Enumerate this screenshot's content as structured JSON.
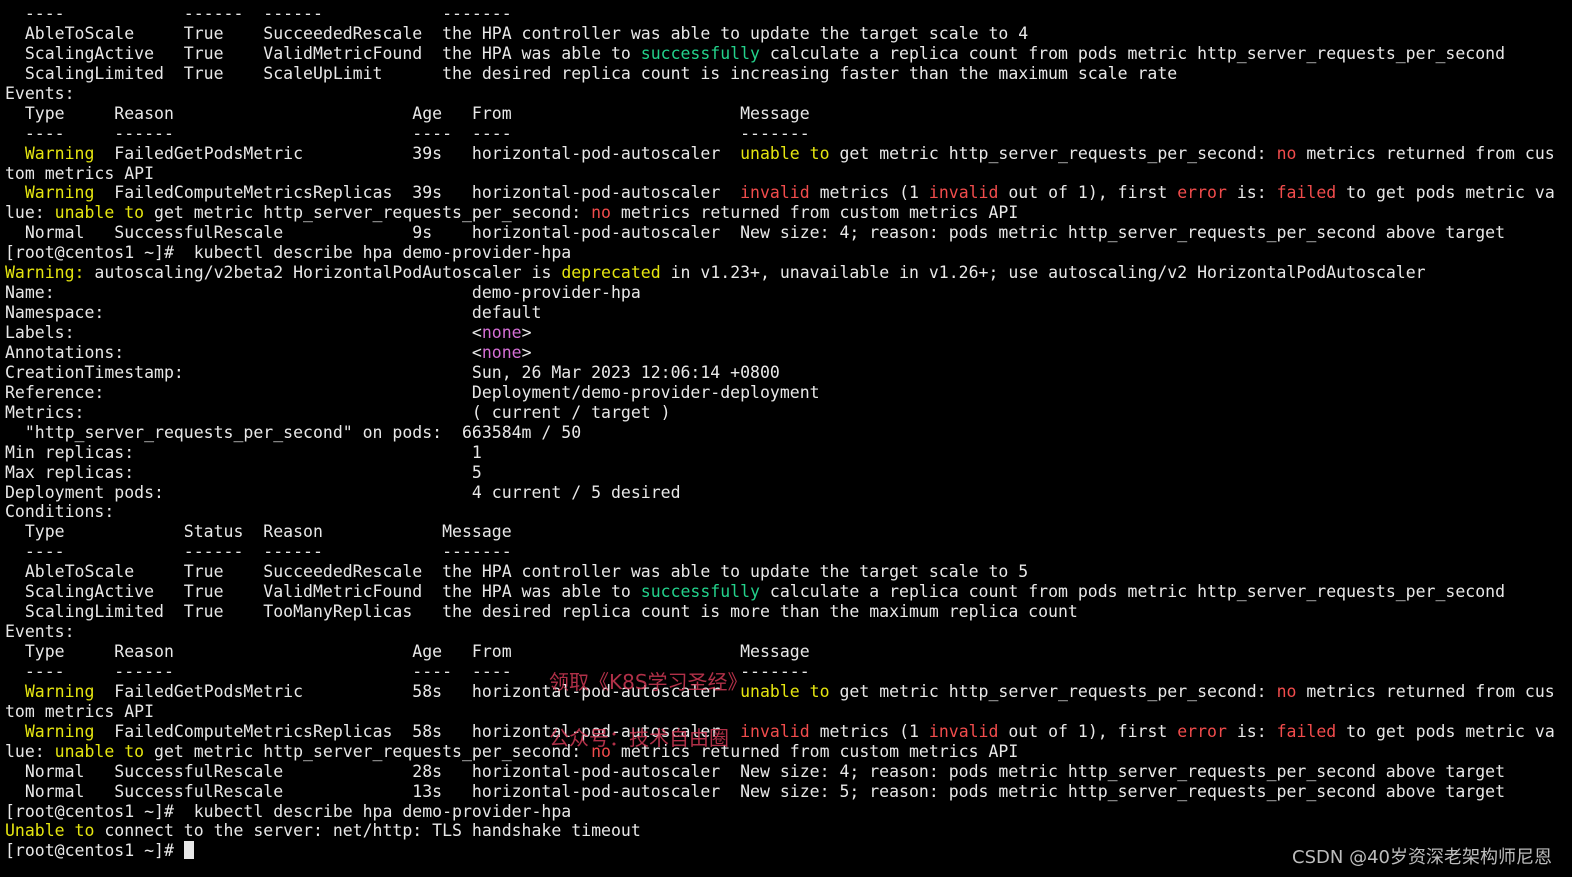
{
  "terminal": {
    "lines": [
      [
        {
          "t": "  ----            ------  ------            -------"
        }
      ],
      [
        {
          "t": "  AbleToScale     True    SucceededRescale  the HPA controller was able to update the target scale to 4"
        }
      ],
      [
        {
          "t": "  ScalingActive   True    ValidMetricFound  the HPA was able to "
        },
        {
          "t": "successfully",
          "c": "g"
        },
        {
          "t": " calculate a replica count from pods metric http_server_requests_per_second"
        }
      ],
      [
        {
          "t": "  ScalingLimited  True    ScaleUpLimit      the desired replica count is increasing faster than the maximum scale rate"
        }
      ],
      [
        {
          "t": "Events:"
        }
      ],
      [
        {
          "t": "  Type     Reason                        Age   From                       Message"
        }
      ],
      [
        {
          "t": "  ----     ------                        ----  ----                       -------"
        }
      ],
      [
        {
          "t": "  "
        },
        {
          "t": "Warning",
          "c": "y"
        },
        {
          "t": "  FailedGetPodsMetric           39s   horizontal-pod-autoscaler  "
        },
        {
          "t": "unable to",
          "c": "y"
        },
        {
          "t": " get metric http_server_requests_per_second: "
        },
        {
          "t": "no",
          "c": "r"
        },
        {
          "t": " metrics returned from cus"
        }
      ],
      [
        {
          "t": "tom metrics API"
        }
      ],
      [
        {
          "t": "  "
        },
        {
          "t": "Warning",
          "c": "y"
        },
        {
          "t": "  FailedComputeMetricsReplicas  39s   horizontal-pod-autoscaler  "
        },
        {
          "t": "invalid",
          "c": "r"
        },
        {
          "t": " metrics (1 "
        },
        {
          "t": "invalid",
          "c": "r"
        },
        {
          "t": " out of 1), first "
        },
        {
          "t": "error",
          "c": "r"
        },
        {
          "t": " is: "
        },
        {
          "t": "failed",
          "c": "r"
        },
        {
          "t": " to get pods metric va"
        }
      ],
      [
        {
          "t": "lue: "
        },
        {
          "t": "unable to",
          "c": "y"
        },
        {
          "t": " get metric http_server_requests_per_second: "
        },
        {
          "t": "no",
          "c": "r"
        },
        {
          "t": " metrics returned from custom metrics API"
        }
      ],
      [
        {
          "t": "  Normal   SuccessfulRescale             9s    horizontal-pod-autoscaler  New size: 4; reason: pods metric http_server_requests_per_second above target"
        }
      ],
      [
        {
          "t": "[root@centos1 ~]#  kubectl describe hpa demo-provider-hpa"
        }
      ],
      [
        {
          "t": "Warning:",
          "c": "y"
        },
        {
          "t": " autoscaling/v2beta2 HorizontalPodAutoscaler is "
        },
        {
          "t": "deprecated",
          "c": "y"
        },
        {
          "t": " in v1.23+, unavailable in v1.26+; use autoscaling/v2 HorizontalPodAutoscaler"
        }
      ],
      [
        {
          "t": "Name:                                          demo-provider-hpa"
        }
      ],
      [
        {
          "t": "Namespace:                                     default"
        }
      ],
      [
        {
          "t": "Labels:                                        <"
        },
        {
          "t": "none",
          "c": "m"
        },
        {
          "t": ">"
        }
      ],
      [
        {
          "t": "Annotations:                                   <"
        },
        {
          "t": "none",
          "c": "m"
        },
        {
          "t": ">"
        }
      ],
      [
        {
          "t": "CreationTimestamp:                             Sun, 26 Mar 2023 12:06:14 +0800"
        }
      ],
      [
        {
          "t": "Reference:                                     Deployment/demo-provider-deployment"
        }
      ],
      [
        {
          "t": "Metrics:                                       ( current / target )"
        }
      ],
      [
        {
          "t": "  \"http_server_requests_per_second\" on pods:  663584m / 50"
        }
      ],
      [
        {
          "t": "Min replicas:                                  1"
        }
      ],
      [
        {
          "t": "Max replicas:                                  5"
        }
      ],
      [
        {
          "t": "Deployment pods:                               4 current / 5 desired"
        }
      ],
      [
        {
          "t": "Conditions:"
        }
      ],
      [
        {
          "t": "  Type            Status  Reason            Message"
        }
      ],
      [
        {
          "t": "  ----            ------  ------            -------"
        }
      ],
      [
        {
          "t": "  AbleToScale     True    SucceededRescale  the HPA controller was able to update the target scale to 5"
        }
      ],
      [
        {
          "t": "  ScalingActive   True    ValidMetricFound  the HPA was able to "
        },
        {
          "t": "successfully",
          "c": "g"
        },
        {
          "t": " calculate a replica count from pods metric http_server_requests_per_second"
        }
      ],
      [
        {
          "t": "  ScalingLimited  True    TooManyReplicas   the desired replica count is more than the maximum replica count"
        }
      ],
      [
        {
          "t": "Events:"
        }
      ],
      [
        {
          "t": "  Type     Reason                        Age   From                       Message"
        }
      ],
      [
        {
          "t": "  ----     ------                        ----  ----                       -------"
        }
      ],
      [
        {
          "t": "  "
        },
        {
          "t": "Warning",
          "c": "y"
        },
        {
          "t": "  FailedGetPodsMetric           58s   horizontal-pod-autoscaler  "
        },
        {
          "t": "unable to",
          "c": "y"
        },
        {
          "t": " get metric http_server_requests_per_second: "
        },
        {
          "t": "no",
          "c": "r"
        },
        {
          "t": " metrics returned from cus"
        }
      ],
      [
        {
          "t": "tom metrics API"
        }
      ],
      [
        {
          "t": "  "
        },
        {
          "t": "Warning",
          "c": "y"
        },
        {
          "t": "  FailedComputeMetricsReplicas  58s   horizontal-pod-autoscaler  "
        },
        {
          "t": "invalid",
          "c": "r"
        },
        {
          "t": " metrics (1 "
        },
        {
          "t": "invalid",
          "c": "r"
        },
        {
          "t": " out of 1), first "
        },
        {
          "t": "error",
          "c": "r"
        },
        {
          "t": " is: "
        },
        {
          "t": "failed",
          "c": "r"
        },
        {
          "t": " to get pods metric va"
        }
      ],
      [
        {
          "t": "lue: "
        },
        {
          "t": "unable to",
          "c": "y"
        },
        {
          "t": " get metric http_server_requests_per_second: "
        },
        {
          "t": "no",
          "c": "r"
        },
        {
          "t": " metrics returned from custom metrics API"
        }
      ],
      [
        {
          "t": "  Normal   SuccessfulRescale             28s   horizontal-pod-autoscaler  New size: 4; reason: pods metric http_server_requests_per_second above target"
        }
      ],
      [
        {
          "t": "  Normal   SuccessfulRescale             13s   horizontal-pod-autoscaler  New size: 5; reason: pods metric http_server_requests_per_second above target"
        }
      ],
      [
        {
          "t": "[root@centos1 ~]#  kubectl describe hpa demo-provider-hpa"
        }
      ],
      [
        {
          "t": "Unable to",
          "c": "y"
        },
        {
          "t": " connect to the server: net/http: TLS handshake timeout"
        }
      ],
      [
        {
          "t": "[root@centos1 ~]# "
        }
      ]
    ]
  },
  "watermark": {
    "line1": "领取《K8S学习圣经》",
    "line2": "公众号：技术自由圈"
  },
  "credit": "CSDN @40岁资深老架构师尼恩",
  "colors": {
    "background": "#000000",
    "foreground": "#e8e8e8",
    "yellow": "#e5e510",
    "red": "#f14c4c",
    "green": "#23d18b",
    "magenta": "#d670d6"
  }
}
